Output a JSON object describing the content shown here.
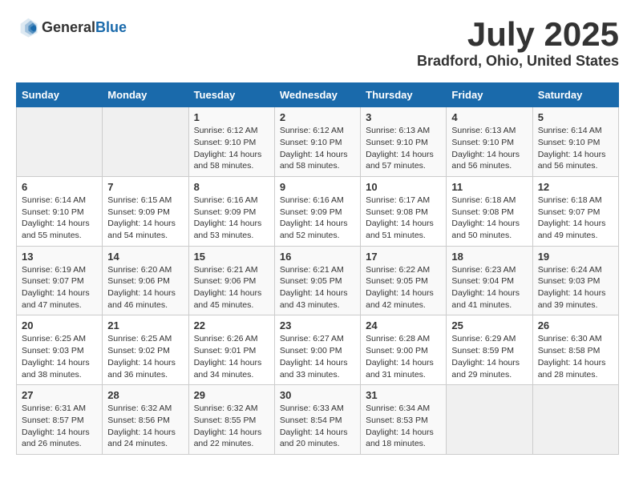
{
  "header": {
    "logo_general": "General",
    "logo_blue": "Blue",
    "month": "July 2025",
    "location": "Bradford, Ohio, United States"
  },
  "weekdays": [
    "Sunday",
    "Monday",
    "Tuesday",
    "Wednesday",
    "Thursday",
    "Friday",
    "Saturday"
  ],
  "weeks": [
    [
      {
        "day": "",
        "empty": true
      },
      {
        "day": "",
        "empty": true
      },
      {
        "day": "1",
        "sunrise": "6:12 AM",
        "sunset": "9:10 PM",
        "daylight": "14 hours and 58 minutes."
      },
      {
        "day": "2",
        "sunrise": "6:12 AM",
        "sunset": "9:10 PM",
        "daylight": "14 hours and 58 minutes."
      },
      {
        "day": "3",
        "sunrise": "6:13 AM",
        "sunset": "9:10 PM",
        "daylight": "14 hours and 57 minutes."
      },
      {
        "day": "4",
        "sunrise": "6:13 AM",
        "sunset": "9:10 PM",
        "daylight": "14 hours and 56 minutes."
      },
      {
        "day": "5",
        "sunrise": "6:14 AM",
        "sunset": "9:10 PM",
        "daylight": "14 hours and 56 minutes."
      }
    ],
    [
      {
        "day": "6",
        "sunrise": "6:14 AM",
        "sunset": "9:10 PM",
        "daylight": "14 hours and 55 minutes."
      },
      {
        "day": "7",
        "sunrise": "6:15 AM",
        "sunset": "9:09 PM",
        "daylight": "14 hours and 54 minutes."
      },
      {
        "day": "8",
        "sunrise": "6:16 AM",
        "sunset": "9:09 PM",
        "daylight": "14 hours and 53 minutes."
      },
      {
        "day": "9",
        "sunrise": "6:16 AM",
        "sunset": "9:09 PM",
        "daylight": "14 hours and 52 minutes."
      },
      {
        "day": "10",
        "sunrise": "6:17 AM",
        "sunset": "9:08 PM",
        "daylight": "14 hours and 51 minutes."
      },
      {
        "day": "11",
        "sunrise": "6:18 AM",
        "sunset": "9:08 PM",
        "daylight": "14 hours and 50 minutes."
      },
      {
        "day": "12",
        "sunrise": "6:18 AM",
        "sunset": "9:07 PM",
        "daylight": "14 hours and 49 minutes."
      }
    ],
    [
      {
        "day": "13",
        "sunrise": "6:19 AM",
        "sunset": "9:07 PM",
        "daylight": "14 hours and 47 minutes."
      },
      {
        "day": "14",
        "sunrise": "6:20 AM",
        "sunset": "9:06 PM",
        "daylight": "14 hours and 46 minutes."
      },
      {
        "day": "15",
        "sunrise": "6:21 AM",
        "sunset": "9:06 PM",
        "daylight": "14 hours and 45 minutes."
      },
      {
        "day": "16",
        "sunrise": "6:21 AM",
        "sunset": "9:05 PM",
        "daylight": "14 hours and 43 minutes."
      },
      {
        "day": "17",
        "sunrise": "6:22 AM",
        "sunset": "9:05 PM",
        "daylight": "14 hours and 42 minutes."
      },
      {
        "day": "18",
        "sunrise": "6:23 AM",
        "sunset": "9:04 PM",
        "daylight": "14 hours and 41 minutes."
      },
      {
        "day": "19",
        "sunrise": "6:24 AM",
        "sunset": "9:03 PM",
        "daylight": "14 hours and 39 minutes."
      }
    ],
    [
      {
        "day": "20",
        "sunrise": "6:25 AM",
        "sunset": "9:03 PM",
        "daylight": "14 hours and 38 minutes."
      },
      {
        "day": "21",
        "sunrise": "6:25 AM",
        "sunset": "9:02 PM",
        "daylight": "14 hours and 36 minutes."
      },
      {
        "day": "22",
        "sunrise": "6:26 AM",
        "sunset": "9:01 PM",
        "daylight": "14 hours and 34 minutes."
      },
      {
        "day": "23",
        "sunrise": "6:27 AM",
        "sunset": "9:00 PM",
        "daylight": "14 hours and 33 minutes."
      },
      {
        "day": "24",
        "sunrise": "6:28 AM",
        "sunset": "9:00 PM",
        "daylight": "14 hours and 31 minutes."
      },
      {
        "day": "25",
        "sunrise": "6:29 AM",
        "sunset": "8:59 PM",
        "daylight": "14 hours and 29 minutes."
      },
      {
        "day": "26",
        "sunrise": "6:30 AM",
        "sunset": "8:58 PM",
        "daylight": "14 hours and 28 minutes."
      }
    ],
    [
      {
        "day": "27",
        "sunrise": "6:31 AM",
        "sunset": "8:57 PM",
        "daylight": "14 hours and 26 minutes."
      },
      {
        "day": "28",
        "sunrise": "6:32 AM",
        "sunset": "8:56 PM",
        "daylight": "14 hours and 24 minutes."
      },
      {
        "day": "29",
        "sunrise": "6:32 AM",
        "sunset": "8:55 PM",
        "daylight": "14 hours and 22 minutes."
      },
      {
        "day": "30",
        "sunrise": "6:33 AM",
        "sunset": "8:54 PM",
        "daylight": "14 hours and 20 minutes."
      },
      {
        "day": "31",
        "sunrise": "6:34 AM",
        "sunset": "8:53 PM",
        "daylight": "14 hours and 18 minutes."
      },
      {
        "day": "",
        "empty": true
      },
      {
        "day": "",
        "empty": true
      }
    ]
  ]
}
